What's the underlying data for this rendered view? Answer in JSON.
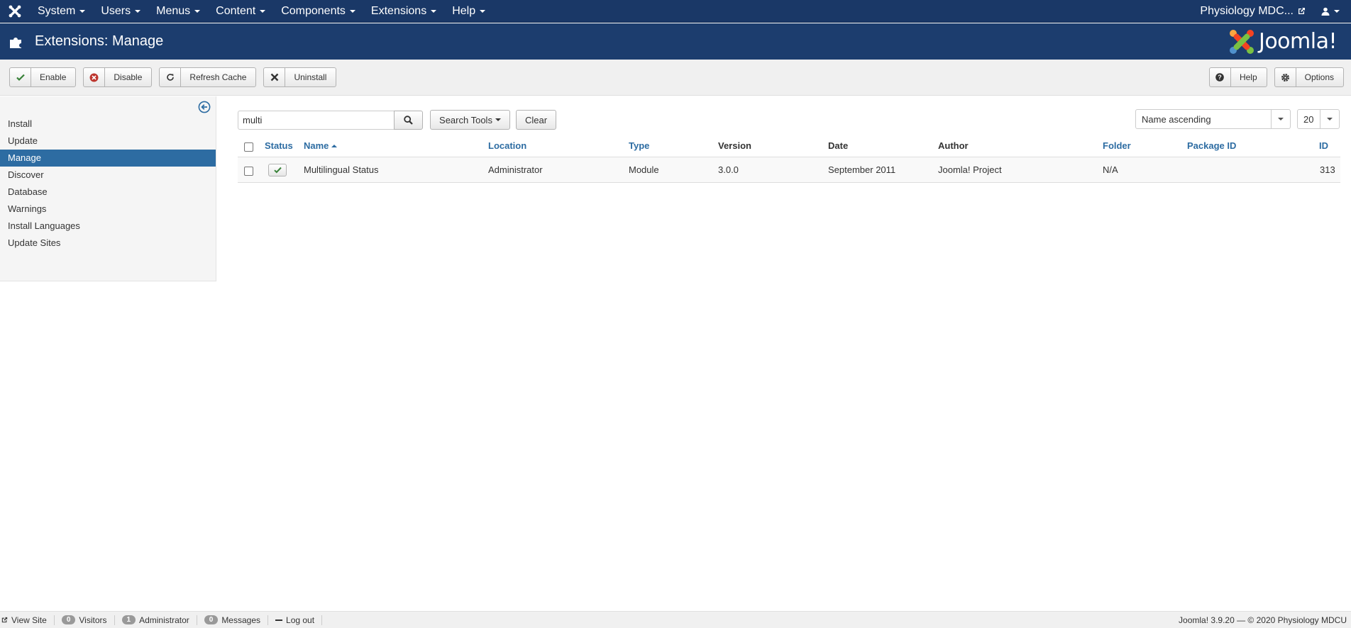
{
  "topnav": {
    "menu": [
      "System",
      "Users",
      "Menus",
      "Content",
      "Components",
      "Extensions",
      "Help"
    ],
    "site_name": "Physiology MDC..."
  },
  "header": {
    "title": "Extensions: Manage",
    "brand": "Joomla!"
  },
  "toolbar": {
    "enable": "Enable",
    "disable": "Disable",
    "refresh_cache": "Refresh Cache",
    "uninstall": "Uninstall",
    "help": "Help",
    "options": "Options"
  },
  "sidebar": {
    "items": [
      "Install",
      "Update",
      "Manage",
      "Discover",
      "Database",
      "Warnings",
      "Install Languages",
      "Update Sites"
    ],
    "active": "Manage"
  },
  "filters": {
    "search_value": "multi",
    "search_tools": "Search Tools",
    "clear": "Clear",
    "ordering": "Name ascending",
    "limit": "20"
  },
  "table": {
    "headers": {
      "status": "Status",
      "name": "Name",
      "location": "Location",
      "type": "Type",
      "version": "Version",
      "date": "Date",
      "author": "Author",
      "folder": "Folder",
      "package_id": "Package ID",
      "id": "ID"
    },
    "rows": [
      {
        "name": "Multilingual Status",
        "location": "Administrator",
        "type": "Module",
        "version": "3.0.0",
        "date": "September 2011",
        "author": "Joomla! Project",
        "folder": "N/A",
        "package_id": "",
        "id": "313",
        "enabled": true
      }
    ]
  },
  "footer": {
    "view_site": "View Site",
    "visitors_count": "0",
    "visitors_label": "Visitors",
    "admins_count": "1",
    "admins_label": "Administrator",
    "messages_count": "0",
    "messages_label": "Messages",
    "logout": "Log out",
    "copyright": "Joomla! 3.9.20  —  © 2020 Physiology MDCU"
  },
  "colors": {
    "topnav_bg": "#1a3867",
    "header_bg": "#1c3d6e",
    "active_item": "#2d6ca2",
    "link": "#2d6ca2",
    "enable_check": "#378137",
    "disable_icon": "#bd362f"
  }
}
